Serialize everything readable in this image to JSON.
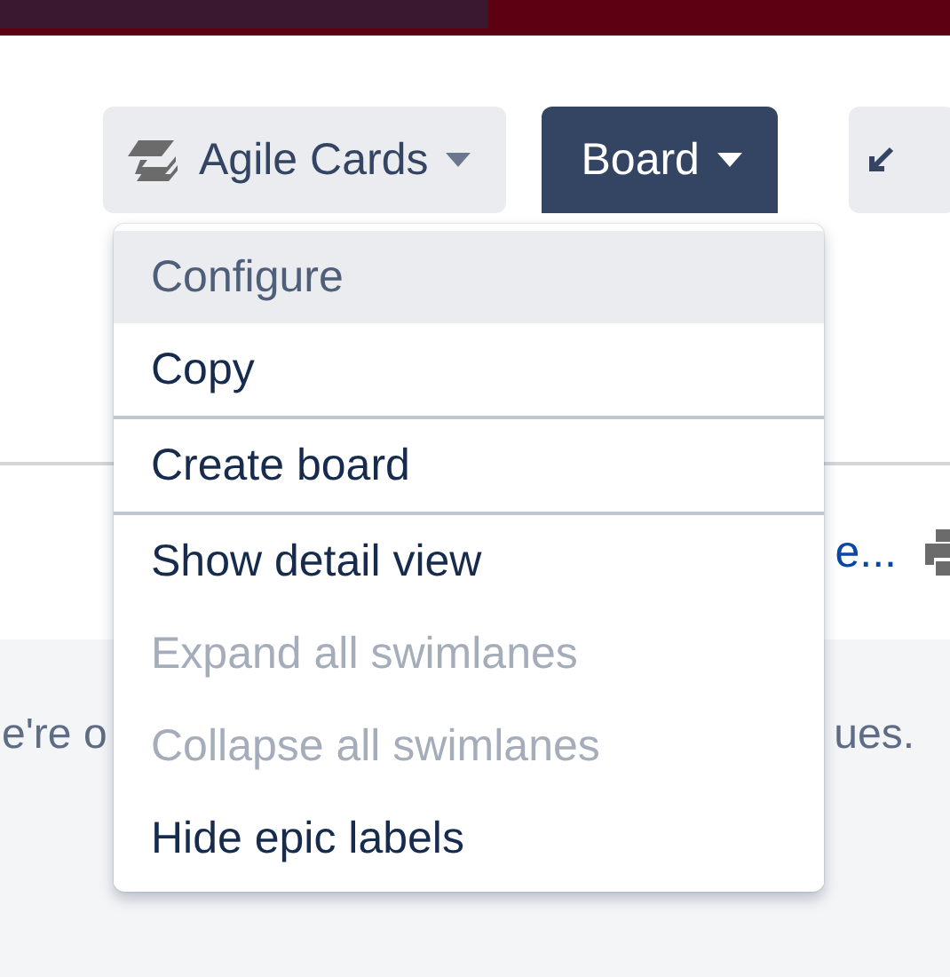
{
  "toolbar": {
    "buttons": [
      {
        "label": "Agile Cards",
        "kind": "dropdown",
        "primary": false
      },
      {
        "label": "Board",
        "kind": "dropdown",
        "primary": true
      },
      {
        "kind": "icon",
        "primary": false
      }
    ]
  },
  "filter_row": {
    "link": "e..."
  },
  "empty_state": {
    "text_left": "e're o",
    "text_right": "ues."
  },
  "menu": {
    "sections": [
      {
        "items": [
          {
            "label": "Configure",
            "selected": true,
            "disabled": false
          },
          {
            "label": "Copy",
            "selected": false,
            "disabled": false
          }
        ]
      },
      {
        "items": [
          {
            "label": "Create board",
            "selected": false,
            "disabled": false
          }
        ]
      },
      {
        "items": [
          {
            "label": "Show detail view",
            "selected": false,
            "disabled": false
          },
          {
            "label": "Expand all swimlanes",
            "selected": false,
            "disabled": true
          },
          {
            "label": "Collapse all swimlanes",
            "selected": false,
            "disabled": true
          },
          {
            "label": "Hide epic labels",
            "selected": false,
            "disabled": false
          }
        ]
      }
    ]
  }
}
